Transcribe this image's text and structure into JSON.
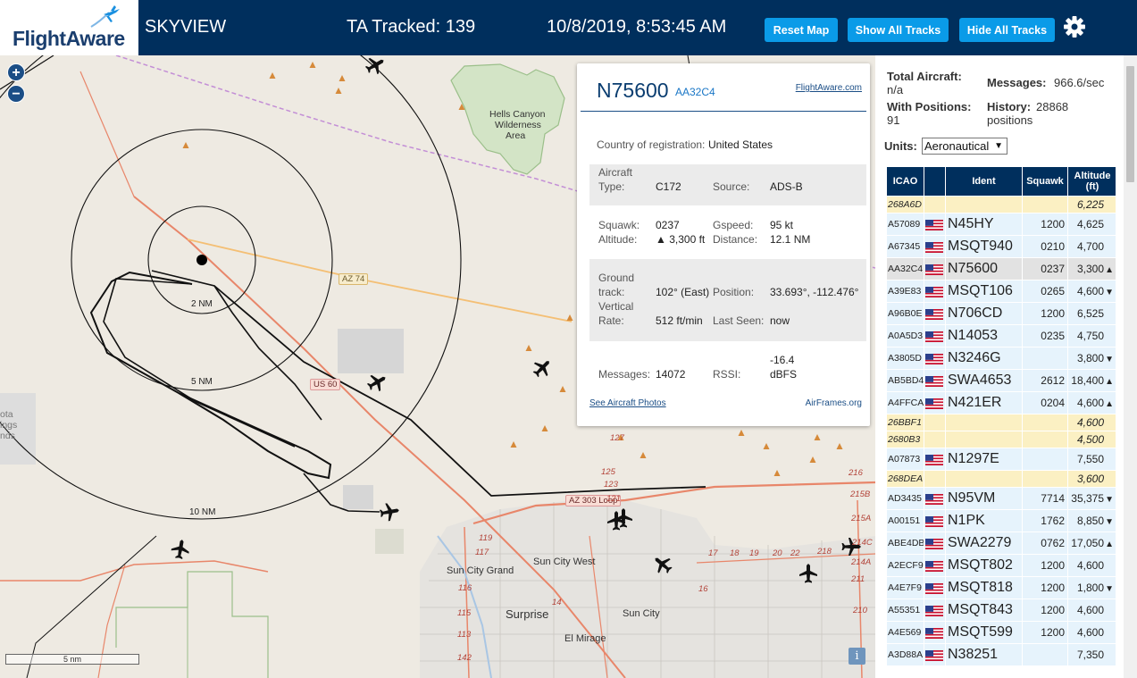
{
  "header": {
    "logo_text": "FlightAware",
    "app_name": "SKYVIEW",
    "ta_tracked": "TA Tracked: 139",
    "clock": "10/8/2019, 8:53:45 AM",
    "buttons": {
      "reset": "Reset Map",
      "show": "Show All Tracks",
      "hide": "Hide All Tracks"
    },
    "settings_icon": "gear-icon"
  },
  "map": {
    "zoom_in": "+",
    "zoom_out": "−",
    "scale": "5 nm",
    "info": "i",
    "rings": [
      "2 NM",
      "5 NM",
      "10 NM"
    ],
    "places": {
      "hells_canyon": "Hells Canyon",
      "wilderness": "Wilderness",
      "area": "Area",
      "sun_city_grand": "Sun City Grand",
      "sun_city_west": "Sun City West",
      "surprise": "Surprise",
      "sun_city": "Sun City",
      "el_mirage": "El Mirage",
      "ota": "ota",
      "ings": "ings",
      "nds": "nds"
    },
    "roads": {
      "az74": "AZ 74",
      "us60": "US 60",
      "az303": "AZ 303 Loop"
    },
    "route_numbers": [
      "127",
      "125",
      "123",
      "121",
      "119",
      "117",
      "116",
      "115",
      "113",
      "142",
      "14",
      "16",
      "17",
      "18",
      "19",
      "20",
      "22",
      "218",
      "216",
      "215B",
      "215A",
      "214C",
      "214A",
      "211",
      "210"
    ]
  },
  "popup": {
    "registration": "N75600",
    "hex": "AA32C4",
    "fa_link": "FlightAware.com",
    "country_label": "Country of registration:",
    "country": "United States",
    "aircraft_type_label_1": "Aircraft",
    "aircraft_type_label_2": "Type:",
    "aircraft_type": "C172",
    "source_label": "Source:",
    "source": "ADS-B",
    "squawk_label": "Squawk:",
    "squawk": "0237",
    "gspeed_label": "Gspeed:",
    "gspeed": "95 kt",
    "altitude_label": "Altitude:",
    "altitude": "▲ 3,300 ft",
    "distance_label": "Distance:",
    "distance": "12.1 NM",
    "ground_label_1": "Ground",
    "ground_label_2": "track:",
    "ground_track": "102° (East)",
    "position_label": "Position:",
    "position": "33.693°, -112.476°",
    "vertical_label_1": "Vertical",
    "vertical_label_2": "Rate:",
    "vertical_rate": "512 ft/min",
    "last_seen_label": "Last Seen:",
    "last_seen": "now",
    "messages_label": "Messages:",
    "messages": "14072",
    "rssi_label": "RSSI:",
    "rssi_1": "-16.4",
    "rssi_2": "dBFS",
    "photos_link": "See Aircraft Photos",
    "airframes_link": "AirFrames.org"
  },
  "sidebar": {
    "total_aircraft_label": "Total Aircraft:",
    "total_aircraft": "n/a",
    "with_positions_label": "With Positions:",
    "with_positions": "91",
    "messages_label": "Messages:",
    "messages": "966.6/sec",
    "history_label": "History:",
    "history": "28868",
    "history_unit": "positions",
    "units_label": "Units:",
    "units_value": "Aeronautical",
    "columns": {
      "icao": "ICAO",
      "ident": "Ident",
      "squawk": "Squawk",
      "altitude_1": "Altitude",
      "altitude_2": "(ft)"
    },
    "rows": [
      {
        "icao": "268A6D",
        "flag": false,
        "ident": "",
        "squawk": "",
        "alt": "6,225",
        "trend": ""
      },
      {
        "icao": "A57089",
        "flag": true,
        "ident": "N45HY",
        "squawk": "1200",
        "alt": "4,625",
        "trend": ""
      },
      {
        "icao": "A67345",
        "flag": true,
        "ident": "MSQT940",
        "squawk": "0210",
        "alt": "4,700",
        "trend": ""
      },
      {
        "icao": "AA32C4",
        "flag": true,
        "ident": "N75600",
        "squawk": "0237",
        "alt": "3,300",
        "trend": "▲"
      },
      {
        "icao": "A39E83",
        "flag": true,
        "ident": "MSQT106",
        "squawk": "0265",
        "alt": "4,600",
        "trend": "▼"
      },
      {
        "icao": "A96B0E",
        "flag": true,
        "ident": "N706CD",
        "squawk": "1200",
        "alt": "6,525",
        "trend": ""
      },
      {
        "icao": "A0A5D3",
        "flag": true,
        "ident": "N14053",
        "squawk": "0235",
        "alt": "4,750",
        "trend": ""
      },
      {
        "icao": "A3805D",
        "flag": true,
        "ident": "N3246G",
        "squawk": "",
        "alt": "3,800",
        "trend": "▼"
      },
      {
        "icao": "AB5BD4",
        "flag": true,
        "ident": "SWA4653",
        "squawk": "2612",
        "alt": "18,400",
        "trend": "▲"
      },
      {
        "icao": "A4FFCA",
        "flag": true,
        "ident": "N421ER",
        "squawk": "0204",
        "alt": "4,600",
        "trend": "▲"
      },
      {
        "icao": "26BBF1",
        "flag": false,
        "ident": "",
        "squawk": "",
        "alt": "4,600",
        "trend": ""
      },
      {
        "icao": "2680B3",
        "flag": false,
        "ident": "",
        "squawk": "",
        "alt": "4,500",
        "trend": ""
      },
      {
        "icao": "A07873",
        "flag": true,
        "ident": "N1297E",
        "squawk": "",
        "alt": "7,550",
        "trend": ""
      },
      {
        "icao": "268DEA",
        "flag": false,
        "ident": "",
        "squawk": "",
        "alt": "3,600",
        "trend": ""
      },
      {
        "icao": "AD3435",
        "flag": true,
        "ident": "N95VM",
        "squawk": "7714",
        "alt": "35,375",
        "trend": "▼"
      },
      {
        "icao": "A00151",
        "flag": true,
        "ident": "N1PK",
        "squawk": "1762",
        "alt": "8,850",
        "trend": "▼"
      },
      {
        "icao": "ABE4DB",
        "flag": true,
        "ident": "SWA2279",
        "squawk": "0762",
        "alt": "17,050",
        "trend": "▲"
      },
      {
        "icao": "A2ECF9",
        "flag": true,
        "ident": "MSQT802",
        "squawk": "1200",
        "alt": "4,600",
        "trend": ""
      },
      {
        "icao": "A4E7F9",
        "flag": true,
        "ident": "MSQT818",
        "squawk": "1200",
        "alt": "1,800",
        "trend": "▼"
      },
      {
        "icao": "A55351",
        "flag": true,
        "ident": "MSQT843",
        "squawk": "1200",
        "alt": "4,600",
        "trend": ""
      },
      {
        "icao": "A4E569",
        "flag": true,
        "ident": "MSQT599",
        "squawk": "1200",
        "alt": "4,600",
        "trend": ""
      },
      {
        "icao": "A3D88A",
        "flag": true,
        "ident": "N38251",
        "squawk": "",
        "alt": "7,350",
        "trend": ""
      }
    ]
  },
  "colors": {
    "header_bg": "#002f5d",
    "button_bg": "#0a9be8",
    "row_bg": "#e6f3fc",
    "noident_bg": "#fbf0c3"
  }
}
